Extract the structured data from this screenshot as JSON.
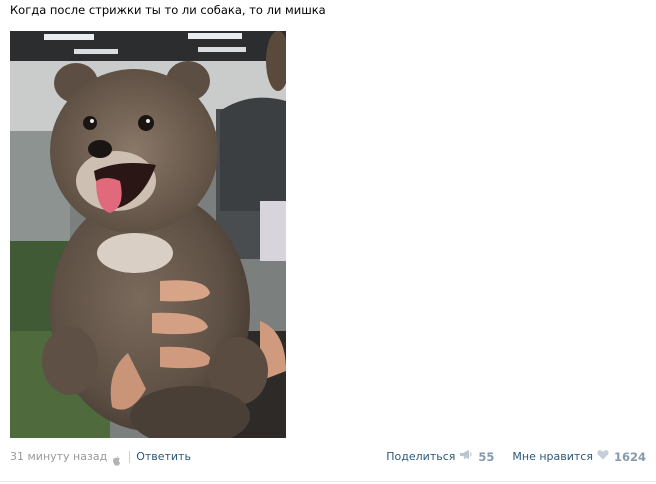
{
  "post": {
    "text": "Когда после стрижки ты то ли собака, то ли мишка",
    "photo_subject": "dog-photo",
    "time": "31 минуту назад",
    "platform_icon": "apple-icon",
    "reply_label": "Ответить",
    "share_label": "Поделиться",
    "share_icon": "megaphone-icon",
    "share_count": "55",
    "like_label": "Мне нравится",
    "like_icon": "heart-icon",
    "like_count": "1624"
  },
  "colors": {
    "link": "#2b587a",
    "muted": "#999999",
    "count": "#849aae"
  }
}
